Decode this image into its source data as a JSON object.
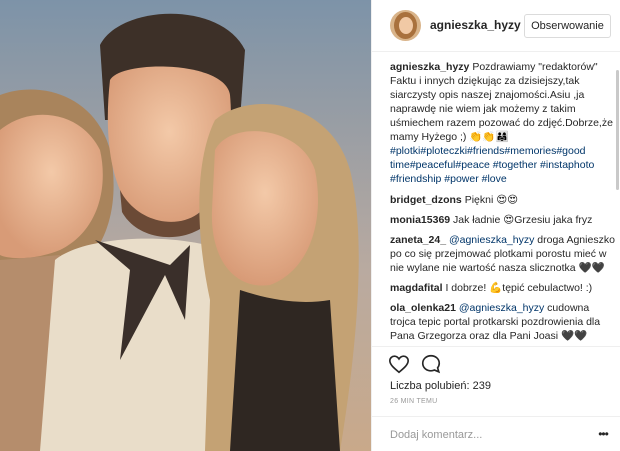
{
  "header": {
    "username": "agnieszka_hyzy",
    "follow_label": "Obserwowanie"
  },
  "caption": {
    "user": "agnieszka_hyzy",
    "text": "Pozdrawiamy \"redaktorów\" Faktu i innych dziękując za dzisiejszy,tak siarczysty opis naszej znajomości.Asiu ,ja naprawdę nie wiem jak możemy z takim uśmiechem razem pozować do zdjęć.Dobrze,że mamy Hyżego ;) 👏👏👨‍👩‍👧",
    "hashtags": "#plotki#ploteczki#friends#memories#good time#peaceful#peace #together #instaphoto #friendship #power #love"
  },
  "comments": [
    {
      "user": "bridget_dzons",
      "mention": "",
      "text": "Piękni 😍😍"
    },
    {
      "user": "monia15369",
      "mention": "",
      "text": "Jak ładnie 😍Grzesiu jaka fryz"
    },
    {
      "user": "zaneta_24_",
      "mention": "@agnieszka_hyzy",
      "text": "droga Agnieszko po co się przejmować plotkami porostu mieć w nie wylane nie wartość nasza slicznotka 🖤🖤"
    },
    {
      "user": "magdafital",
      "mention": "",
      "text": "I dobrze! 💪tępić cebulactwo! :)"
    },
    {
      "user": "ola_olenka21",
      "mention": "@agnieszka_hyzy",
      "text": "cudowna trojca tepic portal protkarski pozdrowienia dla Pana Grzegorza oraz dla Pani Joasi 🖤🖤"
    }
  ],
  "actions": {
    "like_icon": "heart-outline-icon",
    "comment_icon": "comment-bubble-icon"
  },
  "likes": {
    "label": "Liczba polubień:",
    "count": "239"
  },
  "timestamp": "26 MIN TEMU",
  "add_comment": {
    "placeholder": "Dodaj komentarz...",
    "more_label": "•••"
  }
}
